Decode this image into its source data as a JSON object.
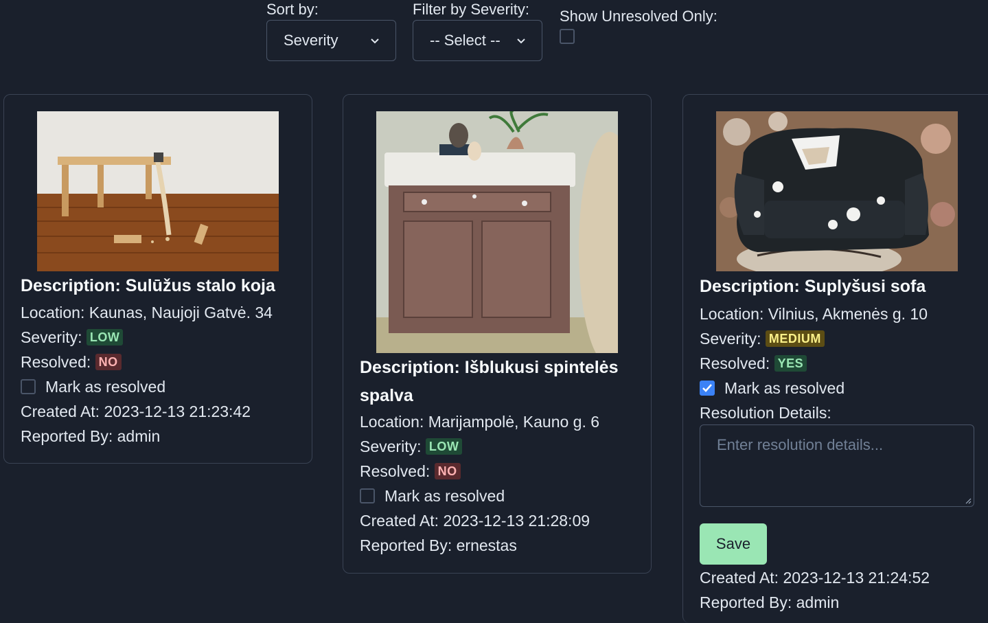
{
  "controls": {
    "sort_label": "Sort by:",
    "sort_value": "Severity",
    "filter_label": "Filter by Severity:",
    "filter_value": "-- Select --",
    "unresolved_label": "Show Unresolved Only:",
    "unresolved_checked": false
  },
  "cards": [
    {
      "description": "Description: Sulūžus stalo koja",
      "location": "Location: Kaunas, Naujoji Gatvė. 34",
      "severity_label": "Severity:",
      "severity": "LOW",
      "resolved_label": "Resolved:",
      "resolved": "NO",
      "mark_label": "Mark as resolved",
      "mark_checked": false,
      "created": "Created At: 2023-12-13 21:23:42",
      "reporter": "Reported By: admin"
    },
    {
      "description": "Description: Išblukusi spintelės spalva",
      "location": "Location: Marijampolė, Kauno g. 6",
      "severity_label": "Severity:",
      "severity": "LOW",
      "resolved_label": "Resolved:",
      "resolved": "NO",
      "mark_label": "Mark as resolved",
      "mark_checked": false,
      "created": "Created At: 2023-12-13 21:28:09",
      "reporter": "Reported By: ernestas"
    },
    {
      "description": "Description: Suplyšusi sofa",
      "location": "Location: Vilnius, Akmenės g. 10",
      "severity_label": "Severity:",
      "severity": "MEDIUM",
      "resolved_label": "Resolved:",
      "resolved": "YES",
      "mark_label": "Mark as resolved",
      "mark_checked": true,
      "resolution_label": "Resolution Details:",
      "resolution_placeholder": "Enter resolution details...",
      "save_label": "Save",
      "created": "Created At: 2023-12-13 21:24:52",
      "reporter": "Reported By: admin"
    }
  ],
  "colors": {
    "background": "#1a202c",
    "low_badge": "#9ae6b4",
    "no_badge": "#feb2b2",
    "medium_badge": "#faf089",
    "save_button": "#9ae6b4",
    "checkbox_checked": "#3b82f6"
  }
}
